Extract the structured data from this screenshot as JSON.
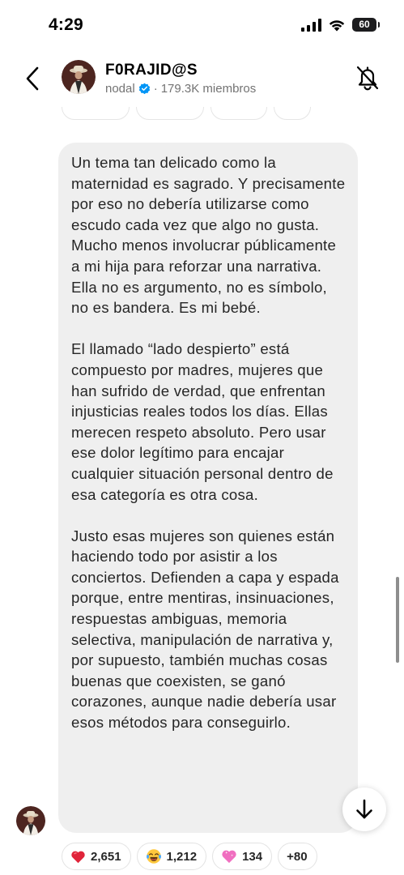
{
  "status_bar": {
    "time": "4:29",
    "battery": "60"
  },
  "header": {
    "title": "F0RAJID@S",
    "creator": "nodal",
    "members": "179.3K miembros"
  },
  "message": {
    "paragraphs": [
      "Un tema tan delicado como la maternidad es sagrado. Y precisamente por eso no debería utilizarse como escudo cada vez que algo no gusta. Mucho menos involucrar públicamente a mi hija para reforzar una narrativa. Ella no es argumento, no es símbolo, no es bandera. Es mi bebé.",
      "El llamado “lado despierto” está compuesto por madres, mujeres que han sufrido de verdad, que enfrentan injusticias reales todos los días. Ellas merecen respeto absoluto. Pero usar ese dolor legítimo para encajar cualquier situación personal dentro de esa categoría es otra cosa.",
      "Justo esas mujeres son quienes están haciendo todo por asistir a los conciertos. Defienden a capa y espada porque, entre mentiras, insinuaciones, respuestas ambiguas, memoria selectiva, manipulación de narrativa y, por supuesto, también muchas cosas buenas que coexisten, se ganó corazones, aunque nadie debería usar esos métodos para conseguirlo."
    ]
  },
  "reactions": [
    {
      "icon": "heart-icon",
      "count": "2,651"
    },
    {
      "icon": "laughing-emoji-icon",
      "count": "1,212"
    },
    {
      "icon": "pink-heart-icon",
      "count": "134"
    },
    {
      "icon": "more-reactions",
      "count": "+80"
    }
  ],
  "colors": {
    "bubble": "#efefef",
    "verified": "#0095f6",
    "text": "#262626",
    "secondary_text": "#737373"
  }
}
